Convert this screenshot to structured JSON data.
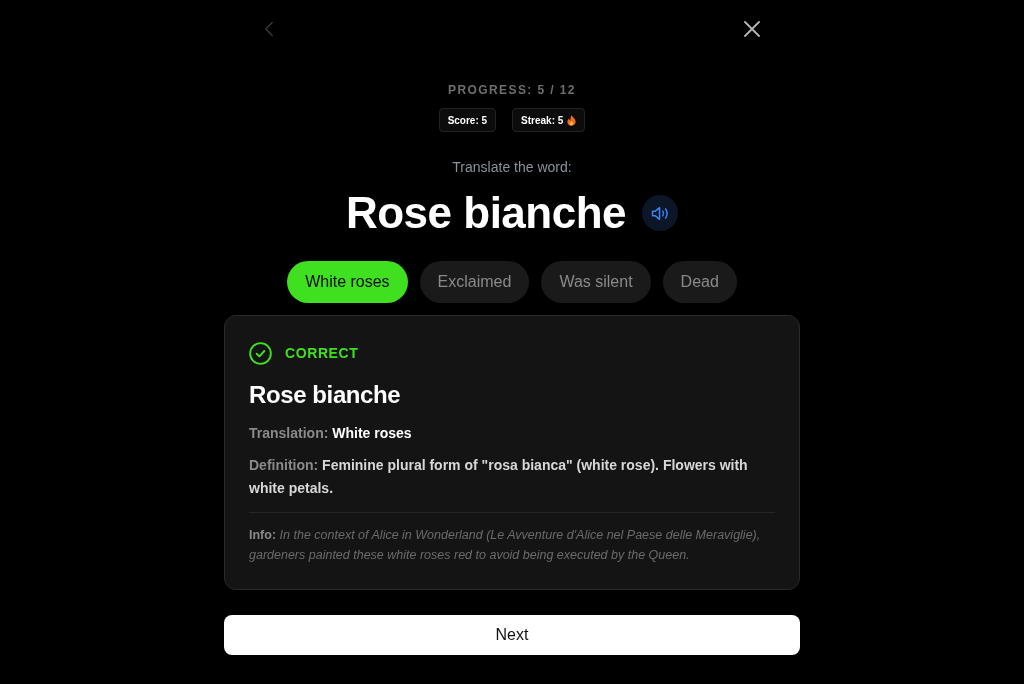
{
  "nav": {
    "back": {
      "disabled": true
    }
  },
  "progress": "PROGRESS: 5 / 12",
  "stats": [
    {
      "kind": "score",
      "text": "Score: 5"
    },
    {
      "kind": "streak",
      "text": "Streak: 5"
    }
  ],
  "prompt": "Translate the word:",
  "word": "Rose bianche",
  "options": [
    {
      "label": "White roses",
      "selected": true
    },
    {
      "label": "Exclaimed",
      "selected": false
    },
    {
      "label": "Was silent",
      "selected": false
    },
    {
      "label": "Dead",
      "selected": false
    }
  ],
  "result": {
    "correct": true,
    "status_label": "CORRECT",
    "word": "Rose bianche",
    "translation": {
      "label": "Translation:",
      "value": "White roses"
    },
    "definition": {
      "label": "Definition:",
      "value": "Feminine plural form of \"rosa bianca\" (white rose). Flowers with white petals."
    },
    "info": {
      "label": "Info:",
      "value": "In the context of Alice in Wonderland (Le Avventure d'Alice nel Paese delle Meraviglie), gardeners painted these white roses red to avoid being executed by the Queen."
    }
  },
  "next_button": "Next"
}
